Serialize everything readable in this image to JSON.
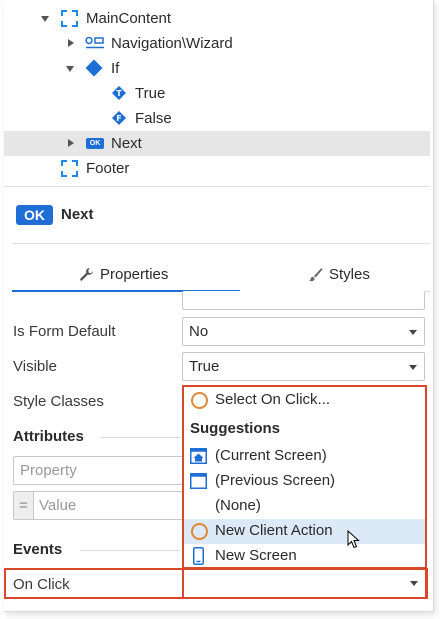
{
  "tree": {
    "main_content": "MainContent",
    "navigation_wizard": "Navigation\\Wizard",
    "if_node": "If",
    "true_branch": "True",
    "false_branch": "False",
    "next_node": "Next",
    "footer": "Footer",
    "next_badge": "OK"
  },
  "header": {
    "badge": "OK",
    "title": "Next"
  },
  "tabs": {
    "properties": "Properties",
    "styles": "Styles"
  },
  "properties": {
    "is_form_default_label": "Is Form Default",
    "is_form_default_value": "No",
    "visible_label": "Visible",
    "visible_value": "True",
    "style_classes_label": "Style Classes"
  },
  "attributes": {
    "title": "Attributes",
    "property_placeholder": "Property",
    "equals": "=",
    "value_placeholder": "Value"
  },
  "events": {
    "title": "Events",
    "on_click_label": "On Click",
    "on_click_value": ""
  },
  "dropdown": {
    "select_item": "Select On Click...",
    "suggestions_header": "Suggestions",
    "items": [
      "(Current Screen)",
      "(Previous Screen)",
      "(None)",
      "New Client Action",
      "New Screen"
    ],
    "hovered_index": 3
  },
  "colors": {
    "accent": "#1e6ed6",
    "highlight_border": "#d9482b",
    "hover_bg": "#dce9f7",
    "circle_orange": "#e0883a"
  }
}
